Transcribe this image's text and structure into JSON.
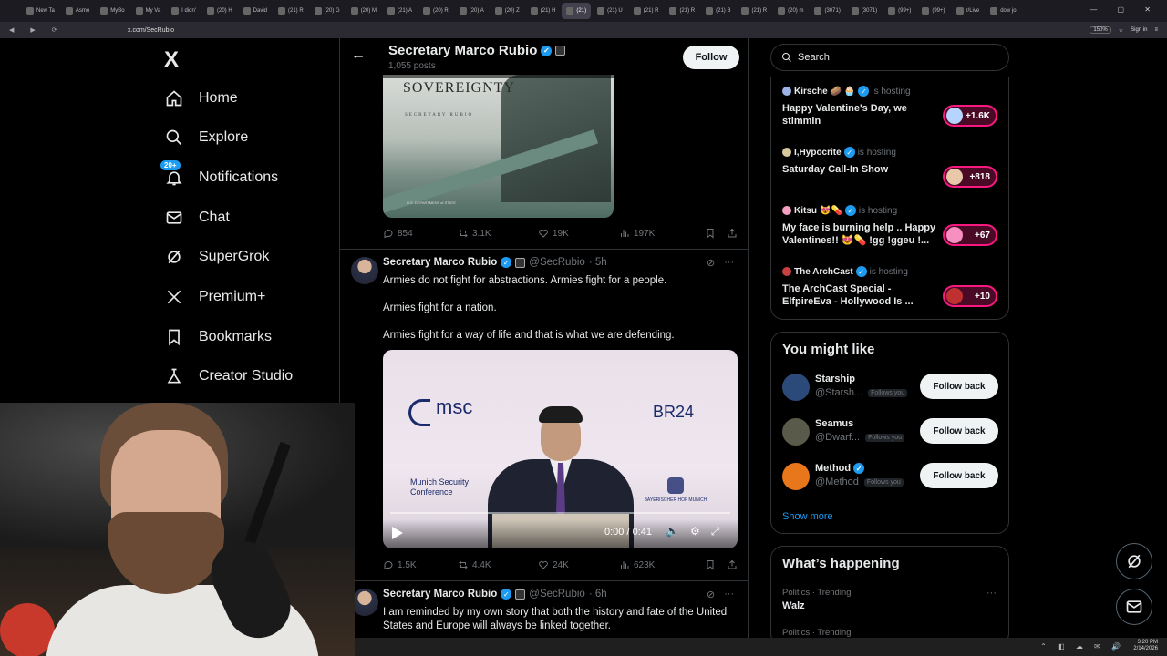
{
  "browser": {
    "tabs": [
      {
        "label": "New Ta",
        "active": false
      },
      {
        "label": "Asmo",
        "active": false
      },
      {
        "label": "MyBo",
        "active": false
      },
      {
        "label": "My Va",
        "active": false
      },
      {
        "label": "I didn'",
        "active": false
      },
      {
        "label": "(20) H",
        "active": false
      },
      {
        "label": "David",
        "active": false
      },
      {
        "label": "(21) R",
        "active": false
      },
      {
        "label": "(20) G",
        "active": false
      },
      {
        "label": "(20) M",
        "active": false
      },
      {
        "label": "(21) A",
        "active": false
      },
      {
        "label": "(20) R",
        "active": false
      },
      {
        "label": "(20) A",
        "active": false
      },
      {
        "label": "(20) Z",
        "active": false
      },
      {
        "label": "(21) H",
        "active": false
      },
      {
        "label": "(21)",
        "active": true
      },
      {
        "label": "(21) U",
        "active": false
      },
      {
        "label": "(21) R",
        "active": false
      },
      {
        "label": "(21) R",
        "active": false
      },
      {
        "label": "(21) B",
        "active": false
      },
      {
        "label": "(21) R",
        "active": false
      },
      {
        "label": "(20) m",
        "active": false
      },
      {
        "label": "(3071)",
        "active": false
      },
      {
        "label": "(3071)",
        "active": false
      },
      {
        "label": "(99+)",
        "active": false
      },
      {
        "label": "(99+)",
        "active": false
      },
      {
        "label": "r/Live",
        "active": false
      },
      {
        "label": "dow jo",
        "active": false
      }
    ],
    "url": "x.com/SecRubio",
    "zoom": "150%",
    "sign_in": "Sign in"
  },
  "nav": {
    "logo": "X",
    "items": [
      {
        "label": "Home",
        "icon": "home-icon"
      },
      {
        "label": "Explore",
        "icon": "search-icon"
      },
      {
        "label": "Notifications",
        "icon": "bell-icon",
        "badge": "20+"
      },
      {
        "label": "Chat",
        "icon": "mail-icon"
      },
      {
        "label": "SuperGrok",
        "icon": "grok-icon"
      },
      {
        "label": "Premium+",
        "icon": "x-icon"
      },
      {
        "label": "Bookmarks",
        "icon": "bookmark-icon"
      },
      {
        "label": "Creator Studio",
        "icon": "creator-icon"
      }
    ]
  },
  "profile_header": {
    "name": "Secretary Marco Rubio",
    "post_count": "1,055 posts",
    "follow_label": "Follow"
  },
  "post0": {
    "image_title": "SOVEREIGNTY",
    "image_sub": "SECRETARY RUBIO",
    "image_dept": "U.S. DEPARTMENT of STATE",
    "replies": "854",
    "reposts": "3.1K",
    "likes": "19K",
    "views": "197K"
  },
  "post1": {
    "name": "Secretary Marco Rubio",
    "handle": "@SecRubio",
    "time": "· 5h",
    "line1": "Armies do not fight for abstractions. Armies fight for a people.",
    "line2": "Armies fight for a nation.",
    "line3": "Armies fight for a way of life and that is what we are defending.",
    "video": {
      "msc": "msc",
      "br24": "BR24",
      "munich": "Munich Security",
      "conference": "Conference",
      "partner": "BAYERISCHER HOF MUNICH",
      "time": "0:00 / 0:41"
    },
    "replies": "1.5K",
    "reposts": "4.4K",
    "likes": "24K",
    "views": "623K"
  },
  "post2": {
    "name": "Secretary Marco Rubio",
    "handle": "@SecRubio",
    "time": "· 6h",
    "line1": "I am reminded by my own story that both the history and fate of the United",
    "line2": "States and Europe will always be linked together."
  },
  "search": {
    "placeholder": "Search"
  },
  "spaces": [
    {
      "host": "Kirsche",
      "emoji": "🥔 🧁",
      "is_hosting": "is hosting",
      "title": "Happy Valentine's Day, we stimmin",
      "count": "+1.6K"
    },
    {
      "host": "I,Hypocrite",
      "emoji": "",
      "is_hosting": "is hosting",
      "title": "Saturday Call-In Show",
      "count": "+818"
    },
    {
      "host": "Kitsu",
      "emoji": "😻💊",
      "is_hosting": "is hosting",
      "title": "My face is burning help .. Happy Valentines!! 😻💊 !gg !ggeu !...",
      "count": "+67"
    },
    {
      "host": "The ArchCast",
      "emoji": "",
      "is_hosting": "is hosting",
      "title": "The ArchCast Special - ElfpireEva - Hollywood Is ...",
      "count": "+10"
    }
  ],
  "who_to_follow": {
    "title": "You might like",
    "items": [
      {
        "name": "Starship",
        "handle": "@Starsh...",
        "follows_you": "Follows you",
        "button": "Follow back",
        "verified": false,
        "color": "#2b4a7a"
      },
      {
        "name": "Seamus",
        "handle": "@Dwarf...",
        "follows_you": "Follows you",
        "button": "Follow back",
        "verified": false,
        "color": "#5a5a4a"
      },
      {
        "name": "Method",
        "handle": "@Method",
        "follows_you": "Follows you",
        "button": "Follow back",
        "verified": true,
        "color": "#e8761b"
      }
    ],
    "show_more": "Show more"
  },
  "happening": {
    "title": "What’s happening",
    "trends": [
      {
        "meta": "Politics · Trending",
        "name": "Walz"
      },
      {
        "meta": "Politics · Trending",
        "name": ""
      }
    ]
  },
  "taskbar": {
    "time": "3:20 PM",
    "date": "2/14/2026"
  }
}
